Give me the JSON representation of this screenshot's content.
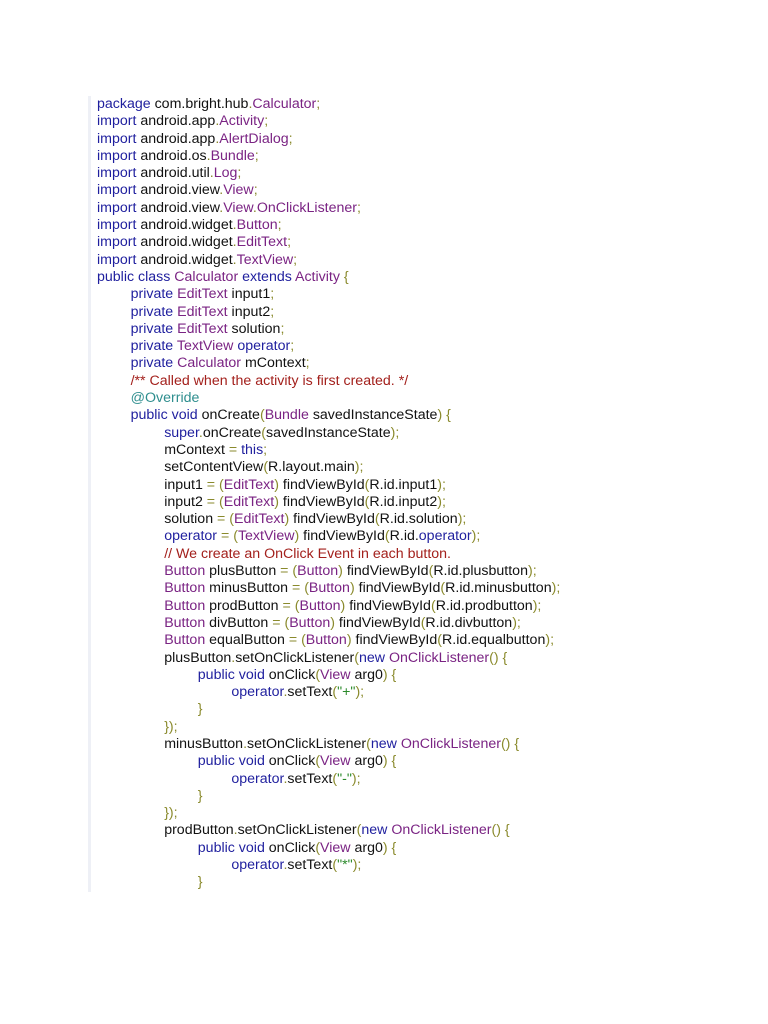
{
  "code": {
    "lines": [
      {
        "i": 0,
        "tk": [
          [
            "package",
            "k"
          ],
          [
            " com.bright.hub",
            ""
          ],
          [
            ".",
            "p"
          ],
          [
            "Calculator",
            "t"
          ],
          [
            ";",
            "p"
          ]
        ]
      },
      {
        "i": 0,
        "tk": [
          [
            "import",
            "k"
          ],
          [
            " android.app",
            ""
          ],
          [
            ".",
            "p"
          ],
          [
            "Activity",
            "t"
          ],
          [
            ";",
            "p"
          ]
        ]
      },
      {
        "i": 0,
        "tk": [
          [
            "import",
            "k"
          ],
          [
            " android.app",
            ""
          ],
          [
            ".",
            "p"
          ],
          [
            "AlertDialog",
            "t"
          ],
          [
            ";",
            "p"
          ]
        ]
      },
      {
        "i": 0,
        "tk": [
          [
            "import",
            "k"
          ],
          [
            " android.os",
            ""
          ],
          [
            ".",
            "p"
          ],
          [
            "Bundle",
            "t"
          ],
          [
            ";",
            "p"
          ]
        ]
      },
      {
        "i": 0,
        "tk": [
          [
            "import",
            "k"
          ],
          [
            " android.util",
            ""
          ],
          [
            ".",
            "p"
          ],
          [
            "Log",
            "t"
          ],
          [
            ";",
            "p"
          ]
        ]
      },
      {
        "i": 0,
        "tk": [
          [
            "import",
            "k"
          ],
          [
            " android.view",
            ""
          ],
          [
            ".",
            "p"
          ],
          [
            "View",
            "t"
          ],
          [
            ";",
            "p"
          ]
        ]
      },
      {
        "i": 0,
        "tk": [
          [
            "import",
            "k"
          ],
          [
            " android.view",
            ""
          ],
          [
            ".",
            "p"
          ],
          [
            "View",
            "t"
          ],
          [
            ".",
            "p"
          ],
          [
            "OnClickListener",
            "t"
          ],
          [
            ";",
            "p"
          ]
        ]
      },
      {
        "i": 0,
        "tk": [
          [
            "import",
            "k"
          ],
          [
            " android.widget",
            ""
          ],
          [
            ".",
            "p"
          ],
          [
            "Button",
            "t"
          ],
          [
            ";",
            "p"
          ]
        ]
      },
      {
        "i": 0,
        "tk": [
          [
            "import",
            "k"
          ],
          [
            " android.widget",
            ""
          ],
          [
            ".",
            "p"
          ],
          [
            "EditText",
            "t"
          ],
          [
            ";",
            "p"
          ]
        ]
      },
      {
        "i": 0,
        "tk": [
          [
            "import",
            "k"
          ],
          [
            " android.widget",
            ""
          ],
          [
            ".",
            "p"
          ],
          [
            "TextView",
            "t"
          ],
          [
            ";",
            "p"
          ]
        ]
      },
      {
        "i": 0,
        "tk": [
          [
            "public class",
            "k"
          ],
          [
            " ",
            ""
          ],
          [
            "Calculator",
            "t"
          ],
          [
            " ",
            ""
          ],
          [
            "extends",
            "k"
          ],
          [
            " ",
            ""
          ],
          [
            "Activity",
            "t"
          ],
          [
            " {",
            "p"
          ]
        ]
      },
      {
        "i": 1,
        "tk": [
          [
            "private",
            "k"
          ],
          [
            " ",
            ""
          ],
          [
            "EditText",
            "t"
          ],
          [
            " input1",
            ""
          ],
          [
            ";",
            "p"
          ]
        ]
      },
      {
        "i": 1,
        "tk": [
          [
            "private",
            "k"
          ],
          [
            " ",
            ""
          ],
          [
            "EditText",
            "t"
          ],
          [
            " input2",
            ""
          ],
          [
            ";",
            "p"
          ]
        ]
      },
      {
        "i": 1,
        "tk": [
          [
            "private",
            "k"
          ],
          [
            " ",
            ""
          ],
          [
            "EditText",
            "t"
          ],
          [
            " solution",
            ""
          ],
          [
            ";",
            "p"
          ]
        ]
      },
      {
        "i": 1,
        "tk": [
          [
            "private",
            "k"
          ],
          [
            " ",
            ""
          ],
          [
            "TextView",
            "t"
          ],
          [
            " ",
            ""
          ],
          [
            "operator",
            "k"
          ],
          [
            ";",
            "p"
          ]
        ]
      },
      {
        "i": 1,
        "tk": [
          [
            "private",
            "k"
          ],
          [
            " ",
            ""
          ],
          [
            "Calculator",
            "t"
          ],
          [
            " mContext",
            ""
          ],
          [
            ";",
            "p"
          ]
        ]
      },
      {
        "i": 1,
        "tk": [
          [
            "/** Called when the activity is first created. */",
            "c"
          ]
        ]
      },
      {
        "i": 1,
        "tk": [
          [
            "@Override",
            "a"
          ]
        ]
      },
      {
        "i": 1,
        "tk": [
          [
            "public void",
            "k"
          ],
          [
            " onCreate",
            ""
          ],
          [
            "(",
            "p"
          ],
          [
            "Bundle",
            "t"
          ],
          [
            " savedInstanceState",
            ""
          ],
          [
            ") {",
            "p"
          ]
        ]
      },
      {
        "i": 2,
        "tk": [
          [
            "super",
            "k"
          ],
          [
            ".",
            "p"
          ],
          [
            "onCreate",
            ""
          ],
          [
            "(",
            "p"
          ],
          [
            "savedInstanceState",
            ""
          ],
          [
            ");",
            "p"
          ]
        ]
      },
      {
        "i": 2,
        "tk": [
          [
            "mContext ",
            ""
          ],
          [
            "=",
            "p"
          ],
          [
            " ",
            ""
          ],
          [
            "this",
            "k"
          ],
          [
            ";",
            "p"
          ]
        ]
      },
      {
        "i": 2,
        "tk": [
          [
            "setContentView",
            ""
          ],
          [
            "(",
            "p"
          ],
          [
            "R.layout.main",
            ""
          ],
          [
            ");",
            "p"
          ]
        ]
      },
      {
        "i": 2,
        "tk": [
          [
            "input1 ",
            ""
          ],
          [
            "= (",
            "p"
          ],
          [
            "EditText",
            "t"
          ],
          [
            ")",
            "p"
          ],
          [
            " findViewById",
            ""
          ],
          [
            "(",
            "p"
          ],
          [
            "R.id.input1",
            ""
          ],
          [
            ");",
            "p"
          ]
        ]
      },
      {
        "i": 2,
        "tk": [
          [
            "input2 ",
            ""
          ],
          [
            "= (",
            "p"
          ],
          [
            "EditText",
            "t"
          ],
          [
            ")",
            "p"
          ],
          [
            " findViewById",
            ""
          ],
          [
            "(",
            "p"
          ],
          [
            "R.id.input2",
            ""
          ],
          [
            ");",
            "p"
          ]
        ]
      },
      {
        "i": 2,
        "tk": [
          [
            "solution ",
            ""
          ],
          [
            "= (",
            "p"
          ],
          [
            "EditText",
            "t"
          ],
          [
            ")",
            "p"
          ],
          [
            " findViewById",
            ""
          ],
          [
            "(",
            "p"
          ],
          [
            "R.id.solution",
            ""
          ],
          [
            ");",
            "p"
          ]
        ]
      },
      {
        "i": 2,
        "tk": [
          [
            "operator",
            "k"
          ],
          [
            " = (",
            "p"
          ],
          [
            "TextView",
            "t"
          ],
          [
            ")",
            "p"
          ],
          [
            " findViewById",
            ""
          ],
          [
            "(",
            "p"
          ],
          [
            "R.id.",
            ""
          ],
          [
            "operator",
            "k"
          ],
          [
            ");",
            "p"
          ]
        ]
      },
      {
        "i": 2,
        "tk": [
          [
            "// We create an OnClick Event in each button.",
            "c"
          ]
        ]
      },
      {
        "i": 2,
        "tk": [
          [
            "Button",
            "t"
          ],
          [
            " plusButton ",
            ""
          ],
          [
            "= (",
            "p"
          ],
          [
            "Button",
            "t"
          ],
          [
            ")",
            "p"
          ],
          [
            " findViewById",
            ""
          ],
          [
            "(",
            "p"
          ],
          [
            "R.id.plusbutton",
            ""
          ],
          [
            ");",
            "p"
          ]
        ]
      },
      {
        "i": 2,
        "tk": [
          [
            "Button",
            "t"
          ],
          [
            " minusButton ",
            ""
          ],
          [
            "= (",
            "p"
          ],
          [
            "Button",
            "t"
          ],
          [
            ")",
            "p"
          ],
          [
            " findViewById",
            ""
          ],
          [
            "(",
            "p"
          ],
          [
            "R.id.minusbutton",
            ""
          ],
          [
            ");",
            "p"
          ]
        ]
      },
      {
        "i": 2,
        "tk": [
          [
            "Button",
            "t"
          ],
          [
            " prodButton ",
            ""
          ],
          [
            "= (",
            "p"
          ],
          [
            "Button",
            "t"
          ],
          [
            ")",
            "p"
          ],
          [
            " findViewById",
            ""
          ],
          [
            "(",
            "p"
          ],
          [
            "R.id.prodbutton",
            ""
          ],
          [
            ");",
            "p"
          ]
        ]
      },
      {
        "i": 2,
        "tk": [
          [
            "Button",
            "t"
          ],
          [
            " divButton ",
            ""
          ],
          [
            "= (",
            "p"
          ],
          [
            "Button",
            "t"
          ],
          [
            ")",
            "p"
          ],
          [
            " findViewById",
            ""
          ],
          [
            "(",
            "p"
          ],
          [
            "R.id.divbutton",
            ""
          ],
          [
            ");",
            "p"
          ]
        ]
      },
      {
        "i": 2,
        "tk": [
          [
            "Button",
            "t"
          ],
          [
            " equalButton ",
            ""
          ],
          [
            "= (",
            "p"
          ],
          [
            "Button",
            "t"
          ],
          [
            ")",
            "p"
          ],
          [
            " findViewById",
            ""
          ],
          [
            "(",
            "p"
          ],
          [
            "R.id.equalbutton",
            ""
          ],
          [
            ");",
            "p"
          ]
        ]
      },
      {
        "i": 2,
        "tk": [
          [
            "plusButton",
            ""
          ],
          [
            ".",
            "p"
          ],
          [
            "setOnClickListener",
            ""
          ],
          [
            "(",
            "p"
          ],
          [
            "new",
            "k"
          ],
          [
            " ",
            ""
          ],
          [
            "OnClickListener",
            "t"
          ],
          [
            "() {",
            "p"
          ]
        ]
      },
      {
        "i": 3,
        "tk": [
          [
            "public void",
            "k"
          ],
          [
            " onClick",
            ""
          ],
          [
            "(",
            "p"
          ],
          [
            "View",
            "t"
          ],
          [
            " arg0",
            ""
          ],
          [
            ") {",
            "p"
          ]
        ]
      },
      {
        "i": 4,
        "tk": [
          [
            "operator",
            "k"
          ],
          [
            ".",
            "p"
          ],
          [
            "setText",
            ""
          ],
          [
            "(",
            "p"
          ],
          [
            "\"+\"",
            "s"
          ],
          [
            ");",
            "p"
          ]
        ]
      },
      {
        "i": 3,
        "tk": [
          [
            "}",
            "p"
          ]
        ]
      },
      {
        "i": 2,
        "tk": [
          [
            "});",
            "p"
          ]
        ]
      },
      {
        "i": 2,
        "tk": [
          [
            "minusButton",
            ""
          ],
          [
            ".",
            "p"
          ],
          [
            "setOnClickListener",
            ""
          ],
          [
            "(",
            "p"
          ],
          [
            "new",
            "k"
          ],
          [
            " ",
            ""
          ],
          [
            "OnClickListener",
            "t"
          ],
          [
            "() {",
            "p"
          ]
        ]
      },
      {
        "i": 3,
        "tk": [
          [
            "public void",
            "k"
          ],
          [
            " onClick",
            ""
          ],
          [
            "(",
            "p"
          ],
          [
            "View",
            "t"
          ],
          [
            " arg0",
            ""
          ],
          [
            ") {",
            "p"
          ]
        ]
      },
      {
        "i": 4,
        "tk": [
          [
            "operator",
            "k"
          ],
          [
            ".",
            "p"
          ],
          [
            "setText",
            ""
          ],
          [
            "(",
            "p"
          ],
          [
            "\"-\"",
            "s"
          ],
          [
            ");",
            "p"
          ]
        ]
      },
      {
        "i": 3,
        "tk": [
          [
            "}",
            "p"
          ]
        ]
      },
      {
        "i": 2,
        "tk": [
          [
            "});",
            "p"
          ]
        ]
      },
      {
        "i": 2,
        "tk": [
          [
            "prodButton",
            ""
          ],
          [
            ".",
            "p"
          ],
          [
            "setOnClickListener",
            ""
          ],
          [
            "(",
            "p"
          ],
          [
            "new",
            "k"
          ],
          [
            " ",
            ""
          ],
          [
            "OnClickListener",
            "t"
          ],
          [
            "() {",
            "p"
          ]
        ]
      },
      {
        "i": 3,
        "tk": [
          [
            "public void",
            "k"
          ],
          [
            " onClick",
            ""
          ],
          [
            "(",
            "p"
          ],
          [
            "View",
            "t"
          ],
          [
            " arg0",
            ""
          ],
          [
            ") {",
            "p"
          ]
        ]
      },
      {
        "i": 4,
        "tk": [
          [
            "operator",
            "k"
          ],
          [
            ".",
            "p"
          ],
          [
            "setText",
            ""
          ],
          [
            "(",
            "p"
          ],
          [
            "\"*\"",
            "s"
          ],
          [
            ");",
            "p"
          ]
        ]
      },
      {
        "i": 3,
        "tk": [
          [
            "}",
            "p"
          ]
        ]
      }
    ]
  }
}
